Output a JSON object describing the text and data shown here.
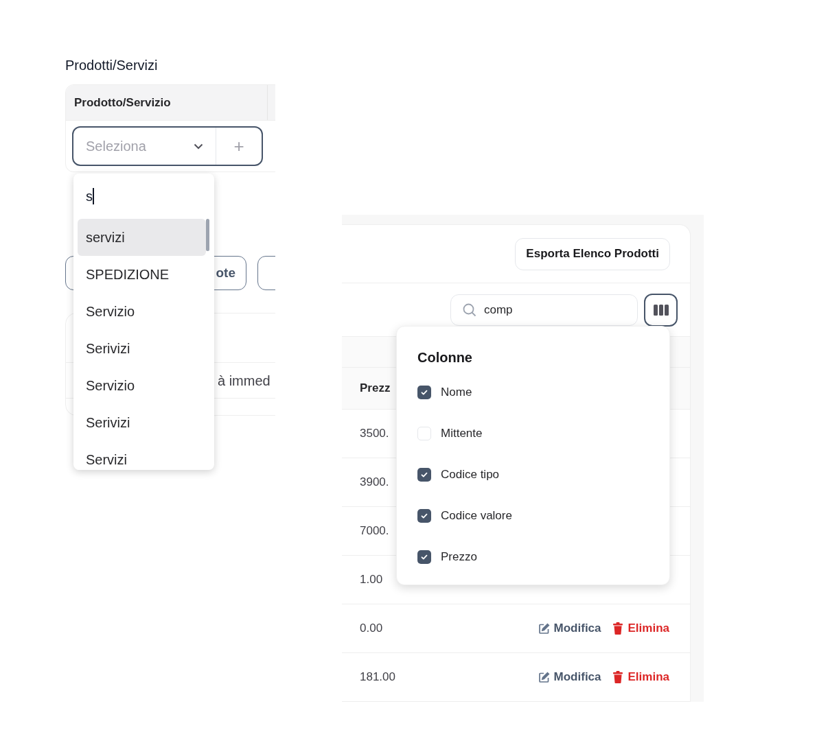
{
  "left_panel": {
    "title": "Prodotti/Servizi",
    "table": {
      "column": "Prodotto/Servizio",
      "select": {
        "placeholder": "Seleziona"
      },
      "add_button": "+"
    },
    "dropdown": {
      "search_value": "s",
      "options": [
        {
          "label": "servizi",
          "selected": true
        },
        {
          "label": "SPEDIZIONE",
          "selected": false
        },
        {
          "label": "Servizio",
          "selected": false
        },
        {
          "label": "Serivizi",
          "selected": false
        },
        {
          "label": "Servizio",
          "selected": false
        },
        {
          "label": "Serivizi",
          "selected": false
        },
        {
          "label": "Servizi",
          "selected": false
        }
      ]
    },
    "covered_button": "ote",
    "covered_row_text": "à immed"
  },
  "right_panel": {
    "export_button": "Esporta Elenco Prodotti",
    "search": {
      "value": "comp"
    },
    "columns_menu": {
      "title": "Colonne",
      "items": [
        {
          "label": "Nome",
          "checked": true
        },
        {
          "label": "Mittente",
          "checked": false
        },
        {
          "label": "Codice tipo",
          "checked": true
        },
        {
          "label": "Codice valore",
          "checked": true
        },
        {
          "label": "Prezzo",
          "checked": true
        }
      ]
    },
    "table": {
      "column_1": "Prezz",
      "rows": [
        {
          "cell": "3500.",
          "actions": []
        },
        {
          "cell": "3900.",
          "actions": []
        },
        {
          "cell": "7000.",
          "actions": []
        },
        {
          "cell": "1.00",
          "actions": []
        },
        {
          "cell": "0.00",
          "actions": [
            {
              "kind": "edit",
              "label": "Modifica"
            },
            {
              "kind": "delete",
              "label": "Elimina"
            }
          ]
        },
        {
          "cell": "181.00",
          "actions": [
            {
              "kind": "edit",
              "label": "Modifica"
            },
            {
              "kind": "delete",
              "label": "Elimina"
            }
          ]
        }
      ]
    }
  }
}
